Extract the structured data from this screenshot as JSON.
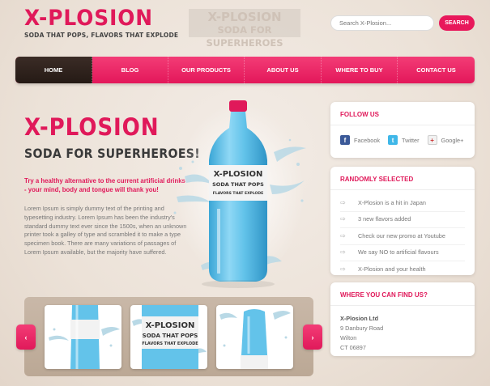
{
  "header": {
    "logo_title": "X-PLOSION",
    "logo_tagline": "SODA THAT POPS, FLAVORS THAT EXPLODE",
    "banner_line1": "X-PLOSION",
    "banner_line2": "SODA FOR SUPERHEROES",
    "search_placeholder": "Search X-Plosion...",
    "search_button": "SEARCH"
  },
  "nav": {
    "items": [
      {
        "label": "HOME"
      },
      {
        "label": "BLOG"
      },
      {
        "label": "OUR PRODUCTS"
      },
      {
        "label": "ABOUT US"
      },
      {
        "label": "WHERE TO BUY"
      },
      {
        "label": "CONTACT US"
      }
    ],
    "active": "HOME"
  },
  "hero": {
    "title": "X-PLOSION",
    "subtitle": "SODA FOR SUPERHEROES!",
    "intro": "Try a healthy alternative to the current artificial drinks - your mind, body and tongue will thank you!",
    "body": "Lorem Ipsum is simply dummy text of the printing and typesetting industry. Lorem Ipsum has been the industry's standard dummy text ever since the 1500s, when an unknown printer took a galley of type and scrambled it to make a type specimen book. There are many variations of passages of Lorem Ipsum available, but the majority have suffered.",
    "bottle_label_1": "X-PLOSION",
    "bottle_label_2": "SODA THAT POPS",
    "bottle_label_3": "FLAVORS THAT EXPLODE"
  },
  "follow": {
    "title": "FOLLOW US",
    "facebook": "Facebook",
    "twitter": "Twitter",
    "google": "Google+"
  },
  "random": {
    "title": "RANDOMLY SELECTED",
    "items": [
      {
        "label": "X-Plosion is a hit in Japan"
      },
      {
        "label": "3 new flavors added"
      },
      {
        "label": "Check our new promo at Youtube"
      },
      {
        "label": "We say NO to artificial flavours"
      },
      {
        "label": "X-Plosion and your health"
      }
    ]
  },
  "find": {
    "title": "WHERE YOU CAN FIND US?",
    "company": "X-Plosion Ltd",
    "street": "9 Danbury Road",
    "city": "Wilton",
    "zip": "CT 06897"
  },
  "gallery": {
    "prev": "‹",
    "next": "›"
  },
  "colors": {
    "accent": "#e0195a",
    "nav_active": "#2c201b",
    "bottle_blue": "#63c3ea"
  }
}
